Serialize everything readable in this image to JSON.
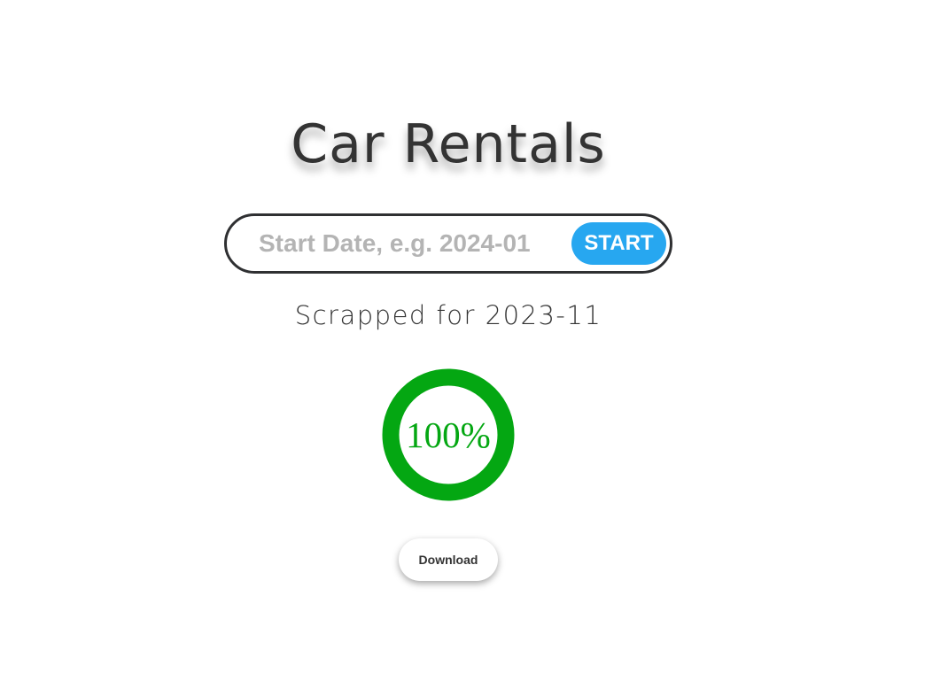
{
  "header": {
    "title": "Car Rentals"
  },
  "search": {
    "placeholder": "Start Date, e.g. 2024-01",
    "value": "",
    "button_label": "START"
  },
  "status": {
    "text": "Scrapped for 2023-11"
  },
  "progress": {
    "value": 100,
    "label": "100%",
    "color": "#04a712"
  },
  "actions": {
    "download_label": "Download"
  },
  "colors": {
    "accent": "#27a7f0",
    "text": "#333333",
    "border": "#2f3032"
  }
}
